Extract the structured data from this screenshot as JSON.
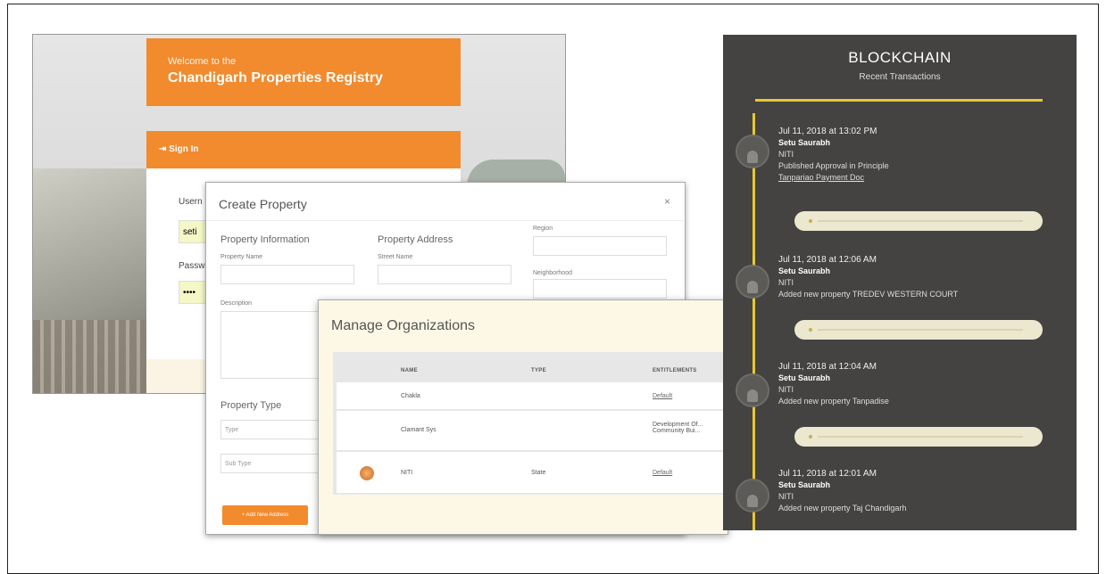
{
  "login": {
    "welcome": "Welcome to the",
    "registry_title": "Chandigarh Properties Registry",
    "signin_bar": "Sign In",
    "username_label": "Usern",
    "username_value": "seti",
    "password_label": "Passw",
    "password_value": "••••"
  },
  "create_property": {
    "title": "Create Property",
    "close": "×",
    "info_heading": "Property Information",
    "address_heading": "Property Address",
    "property_name_label": "Property Name",
    "street_name_label": "Street Name",
    "region_label": "Region",
    "neighborhood_label": "Neighborhood",
    "description_label": "Description",
    "type_heading": "Property Type",
    "type_placeholder": "Type",
    "sub_type_placeholder": "Sub Type",
    "add_button": "+ Add New Address"
  },
  "manage_orgs": {
    "title": "Manage Organizations",
    "columns": [
      "NAME",
      "TYPE",
      "ENTITLEMENTS"
    ],
    "rows": [
      {
        "name": "Chakla",
        "type": "",
        "entitlements": "Default"
      },
      {
        "name": "Clamant Sys",
        "type": "",
        "entitlements": "Development Of... Community Bui..."
      },
      {
        "name": "NITI",
        "type": "State",
        "entitlements": "Default"
      }
    ]
  },
  "blockchain": {
    "title": "BLOCKCHAIN",
    "subtitle": "Recent Transactions",
    "transactions": [
      {
        "date": "Jul 11, 2018 at 13:02 PM",
        "user": "Setu Saurabh",
        "org": "NITI",
        "action": "Published Approval in Principle",
        "link": "Tanpariao Payment Doc"
      },
      {
        "date": "Jul 11, 2018 at 12:06 AM",
        "user": "Setu Saurabh",
        "org": "NITI",
        "action": "Added new property TREDEV WESTERN COURT",
        "link": ""
      },
      {
        "date": "Jul 11, 2018 at 12:04 AM",
        "user": "Setu Saurabh",
        "org": "NITI",
        "action": "Added new property Tanpadise",
        "link": ""
      },
      {
        "date": "Jul 11, 2018 at 12:01 AM",
        "user": "Setu Saurabh",
        "org": "NITI",
        "action": "Added new property Taj Chandigarh",
        "link": ""
      }
    ]
  },
  "colors": {
    "accent_orange": "#f28a2e",
    "chain_bg": "#444341",
    "chain_line": "#e7c830"
  }
}
